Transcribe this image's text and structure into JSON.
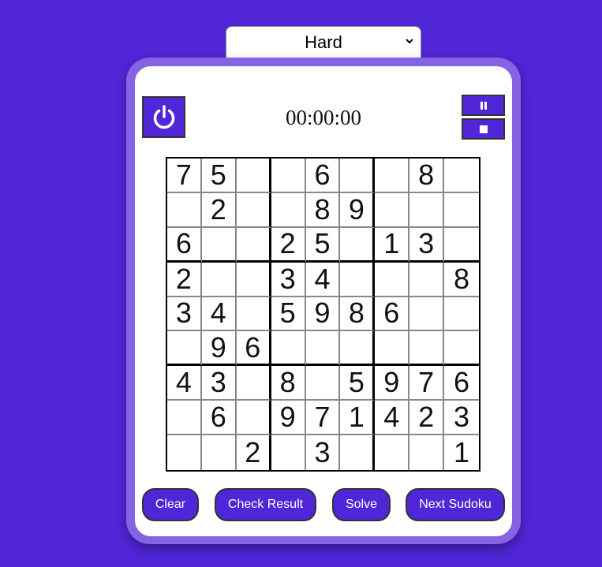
{
  "difficulty": {
    "selected": "Hard"
  },
  "timer": {
    "value": "00:00:00"
  },
  "icons": {
    "power": "power-icon",
    "pause": "pause-icon",
    "stop": "stop-icon",
    "dropdown": "chevron-down-icon"
  },
  "colors": {
    "background": "#5126d8",
    "frame": "#8663e4",
    "card": "#ffffff",
    "button": "#5126d8"
  },
  "board": [
    [
      "7",
      "5",
      "",
      "",
      "6",
      "",
      "",
      "8",
      ""
    ],
    [
      "",
      "2",
      "",
      "",
      "8",
      "9",
      "",
      "",
      ""
    ],
    [
      "6",
      "",
      "",
      "2",
      "5",
      "",
      "1",
      "3",
      ""
    ],
    [
      "2",
      "",
      "",
      "3",
      "4",
      "",
      "",
      "",
      "8"
    ],
    [
      "3",
      "4",
      "",
      "5",
      "9",
      "8",
      "6",
      "",
      ""
    ],
    [
      "",
      "9",
      "6",
      "",
      "",
      "",
      "",
      "",
      ""
    ],
    [
      "4",
      "3",
      "",
      "8",
      "",
      "5",
      "9",
      "7",
      "6"
    ],
    [
      "",
      "6",
      "",
      "9",
      "7",
      "1",
      "4",
      "2",
      "3"
    ],
    [
      "",
      "",
      "2",
      "",
      "3",
      "",
      "",
      "",
      "1"
    ]
  ],
  "buttons": {
    "clear": "Clear",
    "check": "Check Result",
    "solve": "Solve",
    "next": "Next Sudoku"
  }
}
